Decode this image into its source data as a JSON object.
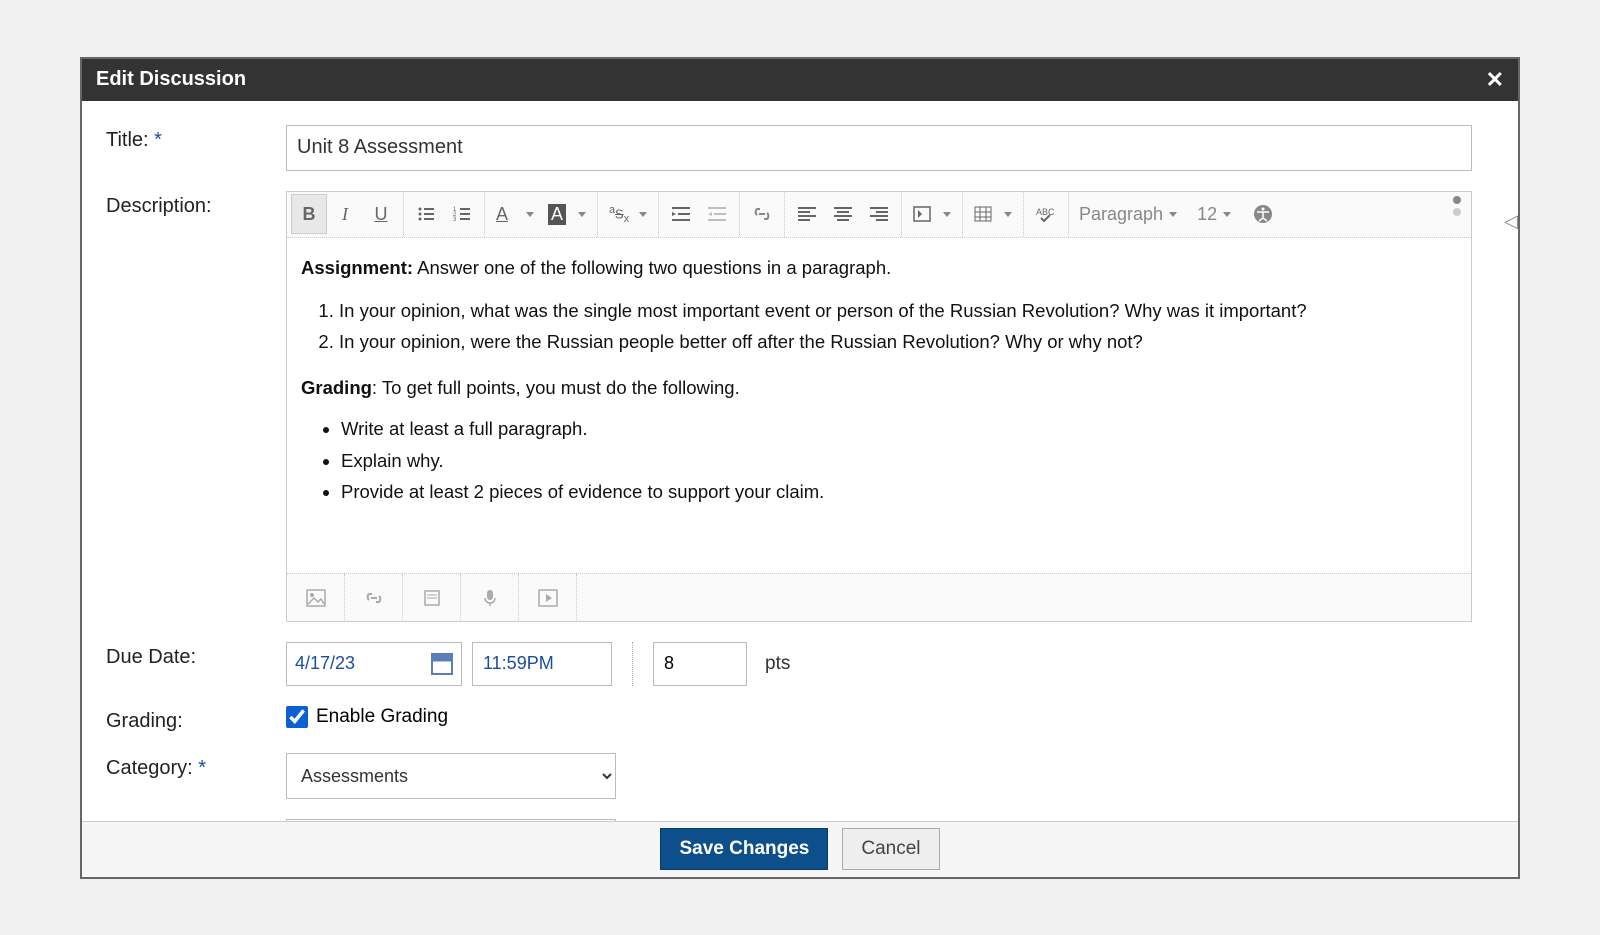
{
  "modal": {
    "title": "Edit Discussion"
  },
  "form": {
    "title_label": "Title:",
    "title_value": "Unit 8 Assessment",
    "description_label": "Description:",
    "due_date_label": "Due Date:",
    "grading_label": "Grading:",
    "category_label": "Category:"
  },
  "editor": {
    "paragraph_select": "Paragraph",
    "fontsize_select": "12",
    "content": {
      "assignment_label": "Assignment:",
      "assignment_text": " Answer one of the following two questions in a paragraph.",
      "q1": "In your opinion, what was the single most important event or person of the Russian Revolution? Why was it important?",
      "q2": "In your opinion, were the Russian people better off after the Russian Revolution? Why or why not?",
      "grading_label": "Grading",
      "grading_text": ": To get full points, you must do the following.",
      "bp1": "Write at least a full paragraph.",
      "bp2": "Explain why.",
      "bp3": "Provide at least 2 pieces of evidence to support your claim."
    }
  },
  "due": {
    "date": "4/17/23",
    "time": "11:59PM",
    "points": "8",
    "points_label": "pts"
  },
  "grading": {
    "enable_label": "Enable Grading",
    "enabled": true
  },
  "category": {
    "selected": "Assessments"
  },
  "footer": {
    "save": "Save Changes",
    "cancel": "Cancel"
  }
}
